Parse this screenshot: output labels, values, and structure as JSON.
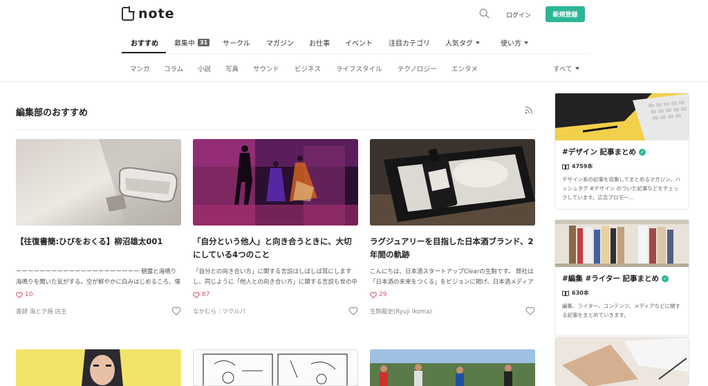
{
  "header": {
    "logo_text": "note",
    "login_label": "ログイン",
    "signup_label": "新規登録"
  },
  "nav": {
    "items": [
      {
        "label": "おすすめ"
      },
      {
        "label": "募集中",
        "badge": "31"
      },
      {
        "label": "サークル"
      },
      {
        "label": "マガジン"
      },
      {
        "label": "お仕事"
      },
      {
        "label": "イベント"
      },
      {
        "label": "注目カテゴリ"
      },
      {
        "label": "人気タグ"
      },
      {
        "label": "使い方"
      }
    ]
  },
  "subnav": {
    "items": [
      "マンガ",
      "コラム",
      "小説",
      "写真",
      "サウンド",
      "ビジネス",
      "ライフスタイル",
      "テクノロジー",
      "エンタメ"
    ],
    "all_label": "すべて"
  },
  "section": {
    "title": "編集部のおすすめ"
  },
  "cards": [
    {
      "title": "【往復書簡:ひびをおくる】柳沼雄太001",
      "desc": "ーーーーーーーーーーーーーーーーーーーーー 朝露と海鳴り　海鳴りを聞いた気がする。空が鮮やかに白みはじめるころ、僕はふと目を覚ました。フロント…",
      "likes": "10",
      "author": "書肆 海と夕焼 店主"
    },
    {
      "title": "「自分という他人」と向き合うときに、大切にしている4つのこと",
      "desc": "「自分との向き合い方」に関する言説はしばしば耳にしますし、同じように「他人との向き合い方」に関する言説も世の中にはたくさんあります。 それぞれ…",
      "likes": "87",
      "author": "なかむら｜ツクルバ"
    },
    {
      "title": "ラグジュアリーを目指した日本酒ブランド、2年間の軌跡",
      "desc": "こんにちは、日本酒スタートアップClearの生駒です。 弊社は「日本酒の未来をつくる」をビジョンに掲げ、日本酒メディアSAKETIMESと、日本酒ブラ…",
      "likes": "29",
      "author": "生駒龍史(Ryuji Ikoma)"
    }
  ],
  "sidebar": [
    {
      "title": "#デザイン 記事まとめ",
      "count": "4759本",
      "desc": "デザイン系の記事を収集してまとめるマガジン。ハッシュタグ #デザイン のついた記事などをチェックしています。広告プロモー…"
    },
    {
      "title": "#編集 #ライター 記事まとめ",
      "count": "630本",
      "desc": "編集、ライター、コンテンツ、メディアなどに関する記事をまとめていきます。"
    }
  ],
  "colors": {
    "accent": "#2cb696",
    "like": "#e0516f"
  }
}
